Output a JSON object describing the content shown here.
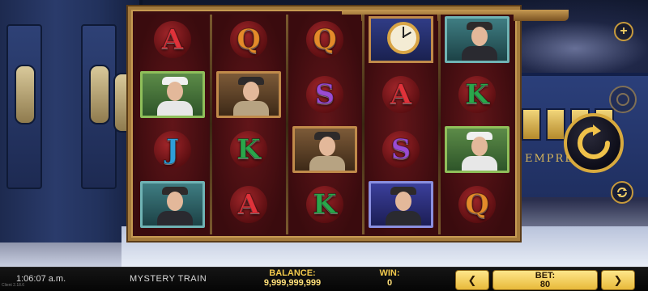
{
  "game": {
    "title": "MYSTERY TRAIN",
    "train_name": "EMPRESS"
  },
  "status": {
    "time": "1:06:07 a.m.",
    "version": "Client 2.18.6"
  },
  "balance": {
    "label": "BALANCE:",
    "value": "9,999,999,999"
  },
  "win": {
    "label": "WIN:",
    "value": "0"
  },
  "bet": {
    "label": "BET:",
    "value": "80",
    "prev": "❮",
    "next": "❯"
  },
  "controls": {
    "plus": "+",
    "spin_icon": "replay-arrow-icon",
    "autoplay_icon": "autoplay-icon"
  },
  "reels": [
    {
      "symbols": [
        "A",
        "portrait-nurse",
        "J",
        "portrait-man-cap"
      ]
    },
    {
      "symbols": [
        "Q",
        "portrait-detective",
        "K",
        "A"
      ]
    },
    {
      "symbols": [
        "Q",
        "S",
        "portrait-detective",
        "K"
      ]
    },
    {
      "symbols": [
        "clock",
        "A",
        "S",
        "portrait-soldier"
      ]
    },
    {
      "symbols": [
        "portrait-man-cap",
        "K",
        "portrait-nurse",
        "Q"
      ]
    }
  ],
  "colors": {
    "A": "#e0323a",
    "Q": "#e48a2a",
    "K": "#2aa64b",
    "J": "#2f9fd9",
    "S": "#9a4bd2",
    "accent": "#f2c94c"
  }
}
